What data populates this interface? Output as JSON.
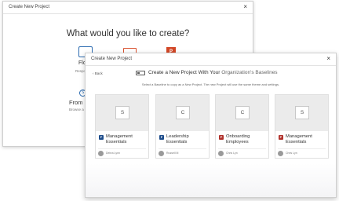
{
  "back_modal": {
    "title": "Create New Project",
    "close_glyph": "×",
    "question": "What would you like to create?",
    "options": [
      {
        "label": "Flo",
        "sub": "Respo",
        "icon": "flow-icon"
      },
      {
        "label": "",
        "icon": "document-icon"
      },
      {
        "label": "",
        "icon": "powerpoint-icon",
        "glyph": "P"
      },
      {
        "label": "From R",
        "sub": "Browse a",
        "icon": "baseline-icon",
        "glyph": "S"
      }
    ]
  },
  "front_modal": {
    "title": "Create New Project",
    "close_glyph": "×",
    "back_label": "‹ Back",
    "heading": "Create a New Project With Your",
    "heading_org": "Organization's Baselines",
    "instruction": "Select a Baseline to copy as a New Project. The new Project will use the same theme and settings.",
    "cards": [
      {
        "letter": "S",
        "badge": "F",
        "badge_color": "#1f4e8c",
        "name": "Management Essentials",
        "owner": "Debra Lynn"
      },
      {
        "letter": "C",
        "badge": "F",
        "badge_color": "#1f4e8c",
        "name": "Leadership Essentials",
        "owner": "Russell M"
      },
      {
        "letter": "C",
        "badge": "P",
        "badge_color": "#b0302a",
        "name": "Onboarding Employees",
        "owner": "Chris Lyn"
      },
      {
        "letter": "S",
        "badge": "P",
        "badge_color": "#b0302a",
        "name": "Management Essentials",
        "owner": "Chris Lyn"
      }
    ]
  }
}
